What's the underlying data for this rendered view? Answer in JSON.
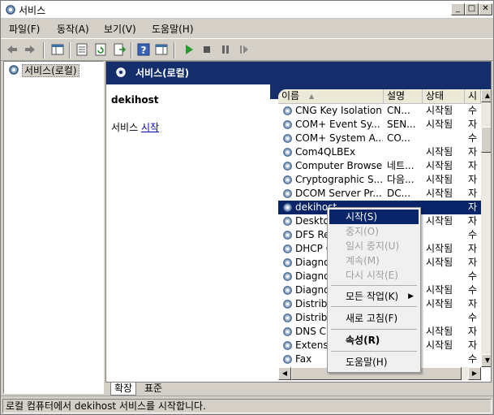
{
  "window": {
    "title": "서비스",
    "min_glyph": "_",
    "max_glyph": "□",
    "close_glyph": "✕"
  },
  "menubar": {
    "file": "파일(F)",
    "action": "동작(A)",
    "view": "보기(V)",
    "help": "도움말(H)"
  },
  "tree": {
    "root_label": "서비스(로컬)"
  },
  "header": {
    "title": "서비스(로컬)"
  },
  "description": {
    "service_name": "dekihost",
    "action_prefix": "서비스",
    "action_link": "시작"
  },
  "list": {
    "columns": [
      "이름",
      "설명",
      "상태",
      "시"
    ],
    "rows": [
      {
        "name": "CNG Key Isolation",
        "desc": "CN...",
        "status": "시작됨",
        "startup": "수"
      },
      {
        "name": "COM+ Event Sy...",
        "desc": "SEN...",
        "status": "시작됨",
        "startup": "자"
      },
      {
        "name": "COM+ System A...",
        "desc": "CO...",
        "status": "",
        "startup": "수"
      },
      {
        "name": "Com4QLBEx",
        "desc": "",
        "status": "시작됨",
        "startup": "자"
      },
      {
        "name": "Computer Browser",
        "desc": "네트...",
        "status": "시작됨",
        "startup": "자"
      },
      {
        "name": "Cryptographic S...",
        "desc": "다음...",
        "status": "시작됨",
        "startup": "자"
      },
      {
        "name": "DCOM Server Pr...",
        "desc": "DC...",
        "status": "시작됨",
        "startup": "자"
      },
      {
        "name": "dekihost",
        "desc": "",
        "status": "",
        "startup": "자"
      },
      {
        "name": "Deskto",
        "desc": "",
        "status": "시작됨",
        "startup": "자"
      },
      {
        "name": "DFS Re",
        "desc": "",
        "status": "",
        "startup": "수"
      },
      {
        "name": "DHCP C",
        "desc": "",
        "status": "시작됨",
        "startup": "자"
      },
      {
        "name": "Diagno",
        "desc": "",
        "status": "시작됨",
        "startup": "자"
      },
      {
        "name": "Diagno",
        "desc": "",
        "status": "",
        "startup": "수"
      },
      {
        "name": "Diagno",
        "desc": "",
        "status": "시작됨",
        "startup": "수"
      },
      {
        "name": "Distribu",
        "desc": "",
        "status": "시작됨",
        "startup": "자"
      },
      {
        "name": "Distribu",
        "desc": "",
        "status": "",
        "startup": "수"
      },
      {
        "name": "DNS C",
        "desc": "",
        "status": "시작됨",
        "startup": "자"
      },
      {
        "name": "Extens",
        "desc": "",
        "status": "시작됨",
        "startup": "자"
      },
      {
        "name": "Fax",
        "desc": "",
        "status": "",
        "startup": "수"
      }
    ]
  },
  "context_menu": {
    "start": "시작(S)",
    "stop": "중지(O)",
    "pause": "일시 중지(U)",
    "resume": "계속(M)",
    "restart": "다시 시작(E)",
    "all_tasks": "모든 작업(K)",
    "refresh": "새로 고침(F)",
    "properties": "속성(R)",
    "help": "도움말(H)"
  },
  "tabs": {
    "extended": "확장",
    "standard": "표준"
  },
  "status": {
    "text": "로컬 컴퓨터에서 dekihost 서비스를 시작합니다."
  },
  "icons": {
    "title": "gear-icon",
    "back": "back-arrow-icon",
    "forward": "forward-arrow-icon",
    "start": "play-icon",
    "stop": "stop-icon",
    "pause": "pause-icon",
    "resume": "resume-icon"
  },
  "colors": {
    "header_band": "#132e6b",
    "selection": "#0a246a",
    "link": "#0000c0"
  }
}
